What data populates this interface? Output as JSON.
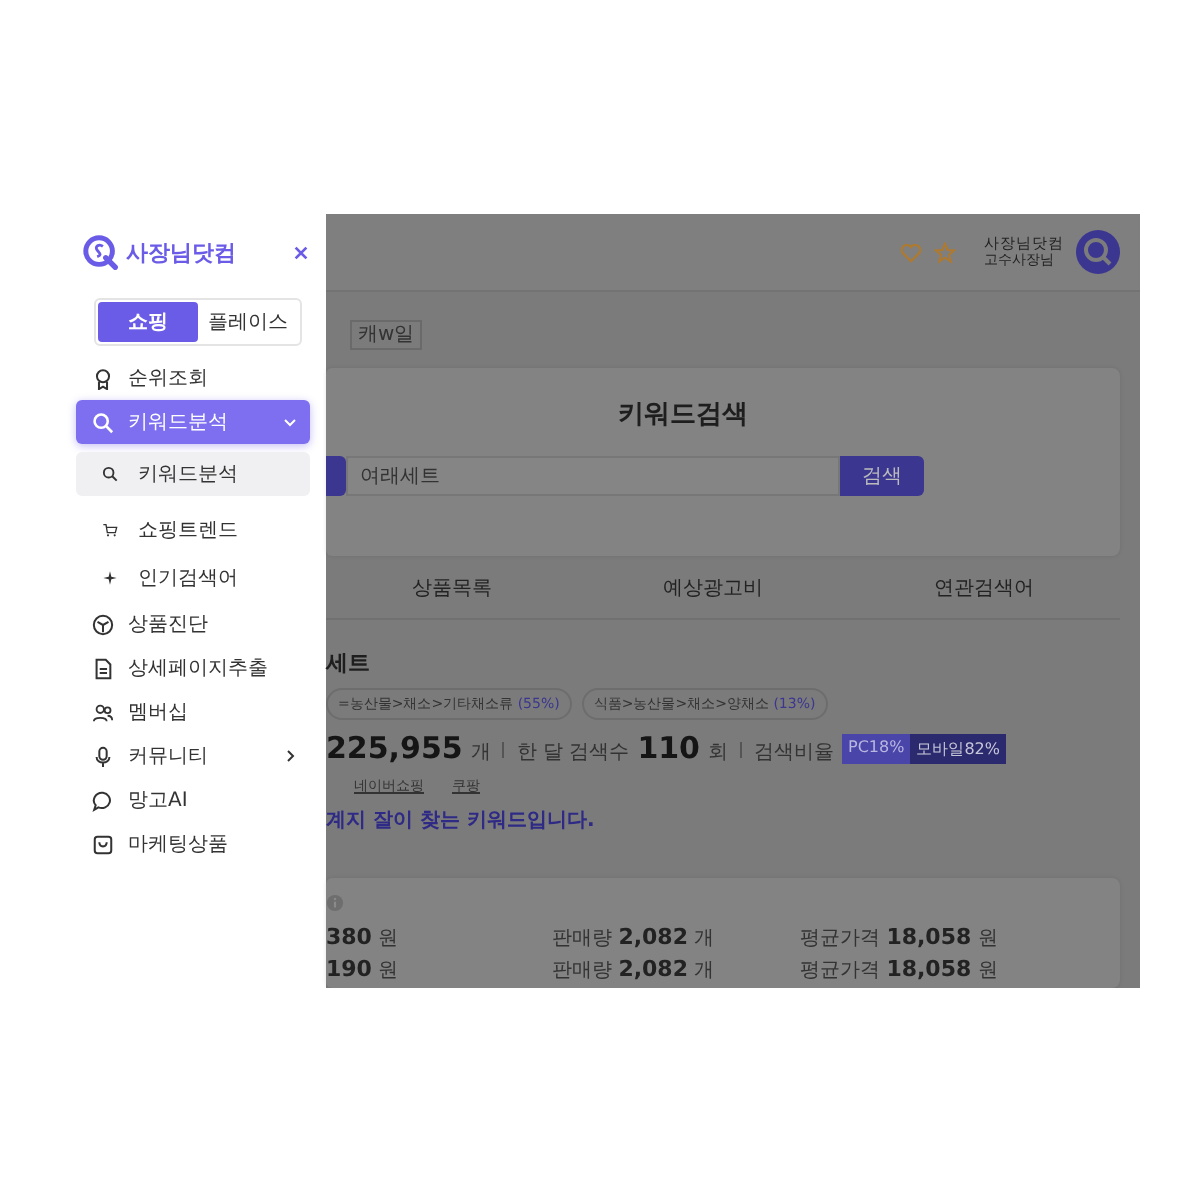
{
  "sidebar": {
    "logo": "사장님닷컴",
    "segments": [
      {
        "label": "쇼핑",
        "selected": true
      },
      {
        "label": "플레이스",
        "selected": false
      }
    ],
    "menu": [
      {
        "label": "순위조회",
        "selected": false
      },
      {
        "label": "키워드분석",
        "selected": true,
        "expanded": true,
        "children": [
          {
            "label": "키워드분석",
            "selected": true
          },
          {
            "label": "쇼핑트렌드",
            "selected": false
          },
          {
            "label": "인기검색어",
            "selected": false
          }
        ]
      },
      {
        "label": "상품진단",
        "selected": false
      },
      {
        "label": "상세페이지추출",
        "selected": false
      },
      {
        "label": "멤버십",
        "selected": false
      },
      {
        "label": "커뮤니티",
        "selected": false,
        "expanded": false
      },
      {
        "label": "망고AI",
        "selected": false
      },
      {
        "label": "마케팅상품",
        "selected": false
      }
    ]
  },
  "header": {
    "user_name": "사장님닷컴",
    "user_level": "고수사장님"
  },
  "tag": "캐w일",
  "keyword_search": {
    "title": "키워드검색",
    "value": "여래세트",
    "button": "검색"
  },
  "tabs": [
    "상품목록",
    "예상광고비",
    "연관검색어"
  ],
  "keyword": {
    "title": "세트",
    "categories": [
      {
        "path": "=농산물>채소>기타채소류",
        "share": "(55%)"
      },
      {
        "path": "식품>농산물>채소>양채소",
        "share": "(13%)"
      }
    ],
    "total": "225,955",
    "total_unit": "개",
    "monthly_label": "한 달 검색수",
    "monthly": "110",
    "monthly_unit": "회",
    "ratio_label": "검색비율",
    "pc": "PC18%",
    "mobile": "모바일82%",
    "links": [
      "네이버쇼핑",
      "쿠팡"
    ],
    "note": "계지 잘이 찾는 키워드입니다."
  },
  "prices": [
    {
      "price": "380",
      "price_unit": "원",
      "sales_label": "판매량",
      "sales": "2,082",
      "sales_unit": "개",
      "avg_label": "평균가격",
      "avg": "18,058",
      "avg_unit": "원"
    },
    {
      "price": "190",
      "price_unit": "원",
      "sales_label": "판매량",
      "sales": "2,082",
      "sales_unit": "개",
      "avg_label": "평균가격",
      "avg": "18,058",
      "avg_unit": "원"
    }
  ]
}
